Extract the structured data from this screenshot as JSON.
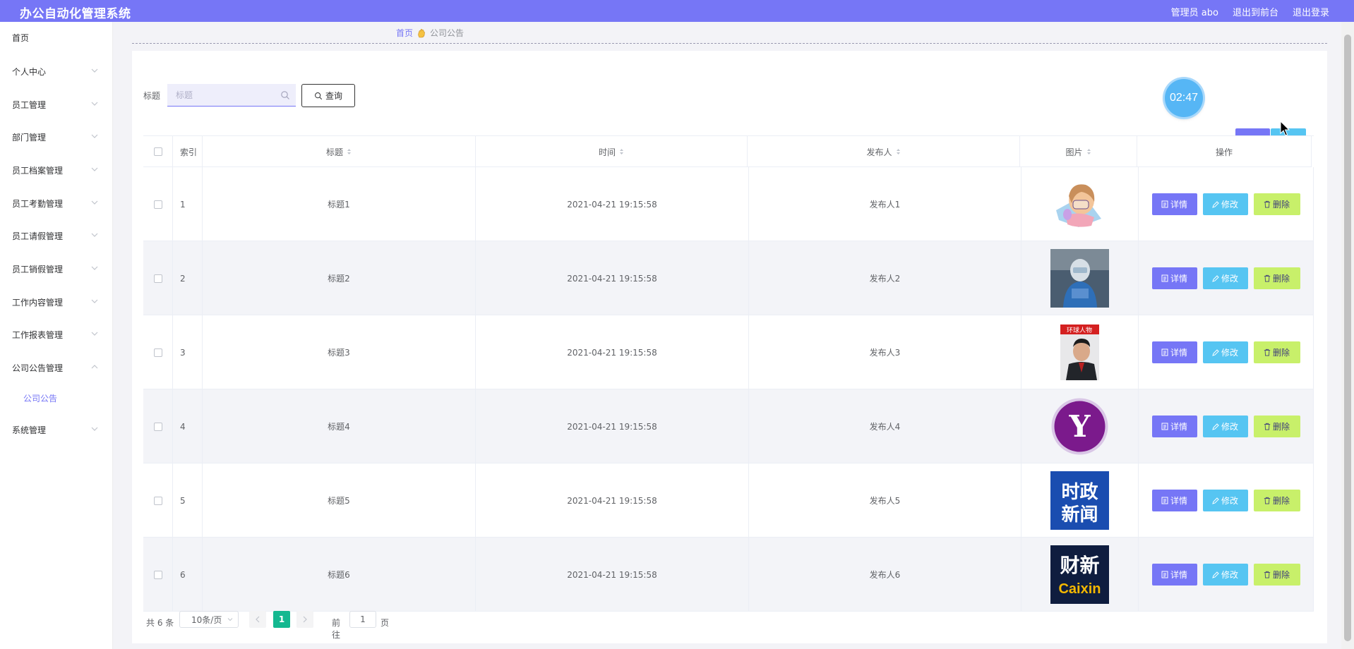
{
  "header": {
    "app_title": "办公自动化管理系统",
    "user_label": "管理员 abo",
    "frontend_link": "退出到前台",
    "logout_link": "退出登录",
    "bg_color": "#7676f6"
  },
  "sidebar": {
    "items": [
      {
        "label": "首页",
        "expandable": false
      },
      {
        "label": "个人中心",
        "expandable": true
      },
      {
        "label": "员工管理",
        "expandable": true
      },
      {
        "label": "部门管理",
        "expandable": true
      },
      {
        "label": "员工档案管理",
        "expandable": true
      },
      {
        "label": "员工考勤管理",
        "expandable": true
      },
      {
        "label": "员工请假管理",
        "expandable": true
      },
      {
        "label": "员工销假管理",
        "expandable": true
      },
      {
        "label": "工作内容管理",
        "expandable": true
      },
      {
        "label": "工作报表管理",
        "expandable": true
      },
      {
        "label": "公司公告管理",
        "expandable": true,
        "expanded": true
      },
      {
        "label": "公司公告",
        "submenu": true,
        "active": true
      },
      {
        "label": "系统管理",
        "expandable": true
      }
    ]
  },
  "breadcrumb": {
    "home": "首页",
    "current": "公司公告"
  },
  "search": {
    "label": "标题",
    "placeholder": "标题",
    "value": "",
    "button_label": "查询"
  },
  "timer": "02:47",
  "table": {
    "columns": [
      "索引",
      "标题",
      "时间",
      "发布人",
      "图片",
      "操作"
    ],
    "rows": [
      {
        "index": "1",
        "title": "标题1",
        "time": "2021-04-21 19:15:58",
        "publisher": "发布人1",
        "image": "cartoon-girl-sleeping"
      },
      {
        "index": "2",
        "title": "标题2",
        "time": "2021-04-21 19:15:58",
        "publisher": "发布人2",
        "image": "medical-worker-photo"
      },
      {
        "index": "3",
        "title": "标题3",
        "time": "2021-04-21 19:15:58",
        "publisher": "发布人3",
        "image": "magazine-cover"
      },
      {
        "index": "4",
        "title": "标题4",
        "time": "2021-04-21 19:15:58",
        "publisher": "发布人4",
        "image": "yahoo-logo"
      },
      {
        "index": "5",
        "title": "标题5",
        "time": "2021-04-21 19:15:58",
        "publisher": "发布人5",
        "image": "news-logo"
      },
      {
        "index": "6",
        "title": "标题6",
        "time": "2021-04-21 19:15:58",
        "publisher": "发布人6",
        "image": "caixin-logo"
      }
    ],
    "actions": {
      "detail": "详情",
      "edit": "修改",
      "remove": "删除"
    }
  },
  "pager": {
    "total": "共 6 条",
    "page_size": "10条/页",
    "current_page": "1",
    "goto_label": "前往",
    "goto_value": "1",
    "page_suffix": "页"
  },
  "image_text": {
    "magazine_title": "环球人物",
    "news_line1": "时政",
    "news_line2": "新闻",
    "caixin_cn": "财新",
    "caixin_en": "Caixin",
    "yahoo": "Y"
  },
  "colors": {
    "accent": "#7676f6",
    "detail_btn": "#7676f6",
    "edit_btn": "#56c5f2",
    "remove_btn": "#c8f06a",
    "page_active": "#14b890"
  }
}
